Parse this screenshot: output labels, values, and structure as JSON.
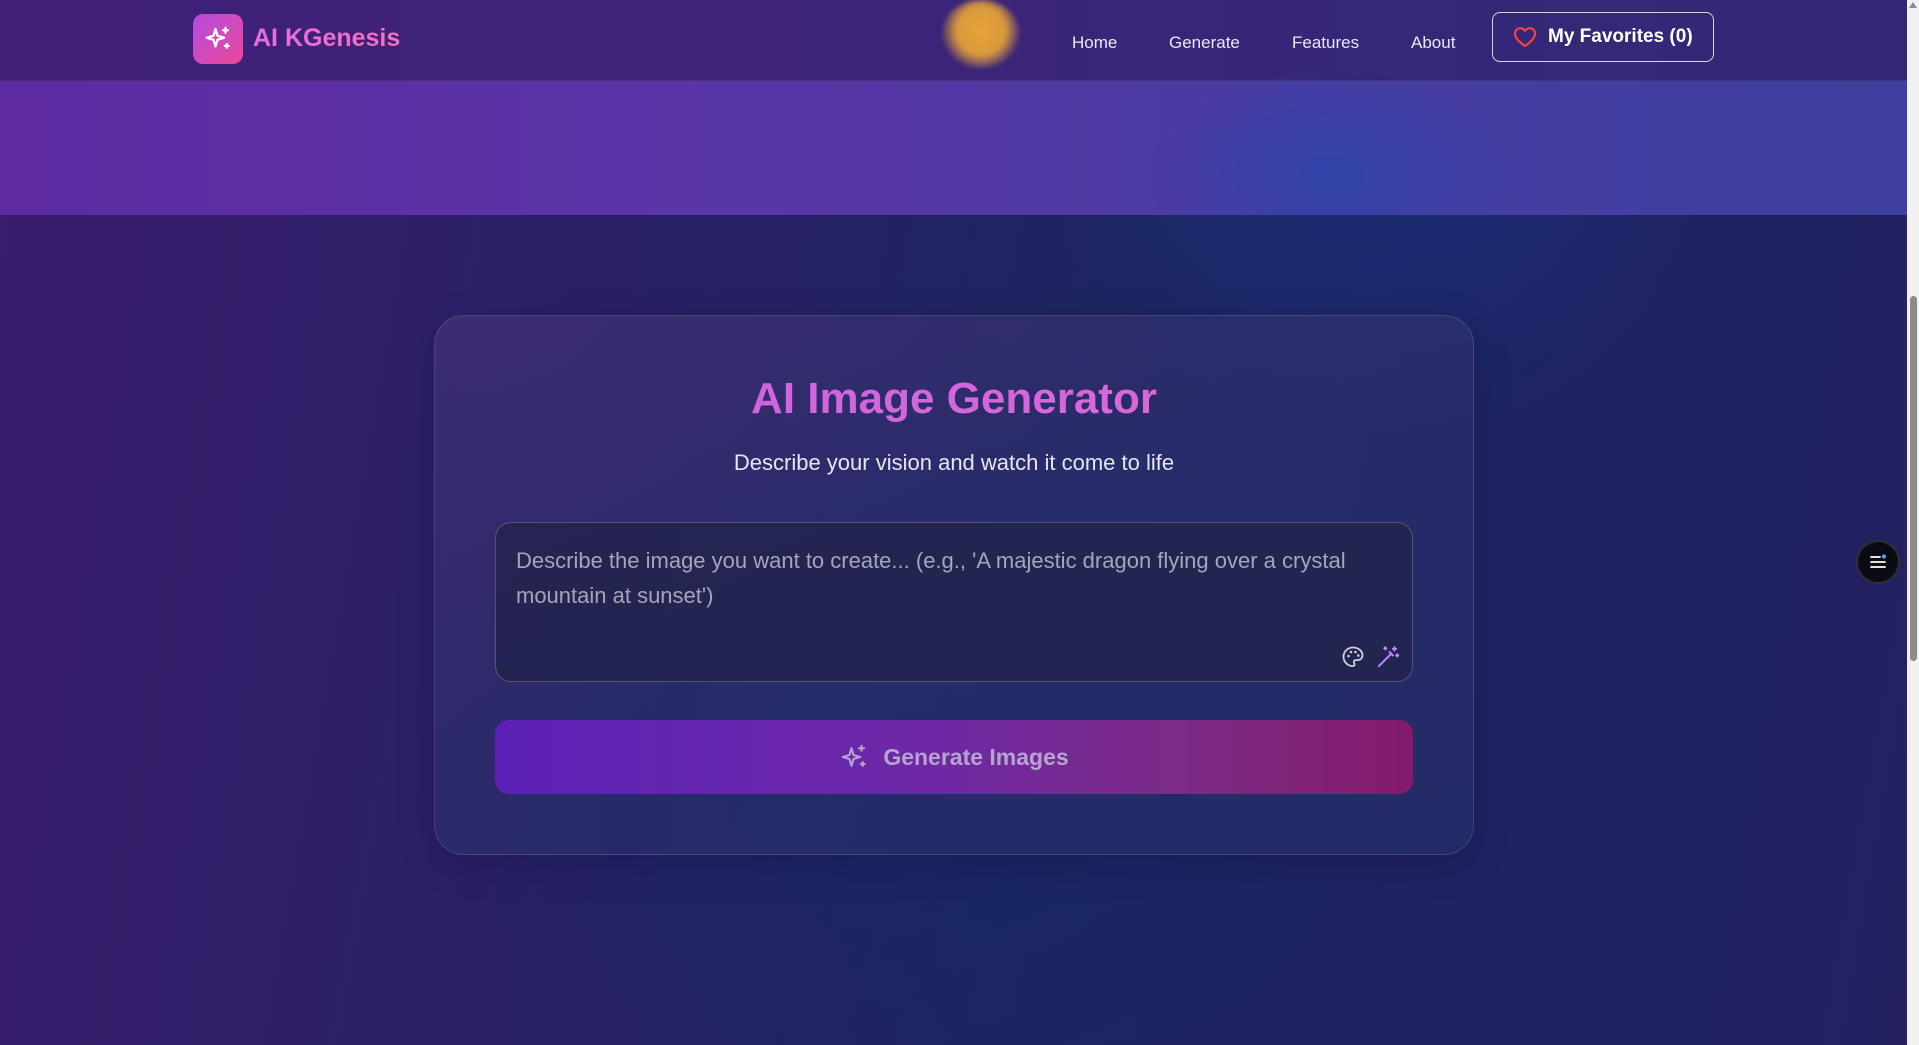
{
  "brand": {
    "name": "AI KGenesis",
    "icon": "sparkles-icon"
  },
  "nav": {
    "items": [
      {
        "label": "Home"
      },
      {
        "label": "Generate"
      },
      {
        "label": "Features"
      },
      {
        "label": "About"
      }
    ],
    "favorites_label": "My Favorites (0)",
    "favorites_icon": "heart-icon"
  },
  "generator": {
    "title": "AI Image Generator",
    "subtitle": "Describe your vision and watch it come to life",
    "prompt_placeholder": "Describe the image you want to create... (e.g., 'A majestic dragon flying over a crystal mountain at sunset')",
    "prompt_value": "",
    "tools": [
      {
        "icon": "palette-icon"
      },
      {
        "icon": "magic-wand-icon"
      }
    ],
    "generate_label": "Generate Images",
    "generate_icon": "sparkles-icon"
  },
  "floating_menu": {
    "icon": "menu-icon"
  },
  "colors": {
    "accent_pink": "#e26ee6",
    "accent_purple": "#5b21b6",
    "heart_red": "#ef4444",
    "wand_purple": "#c084fc",
    "background_navy": "#1e2363"
  }
}
